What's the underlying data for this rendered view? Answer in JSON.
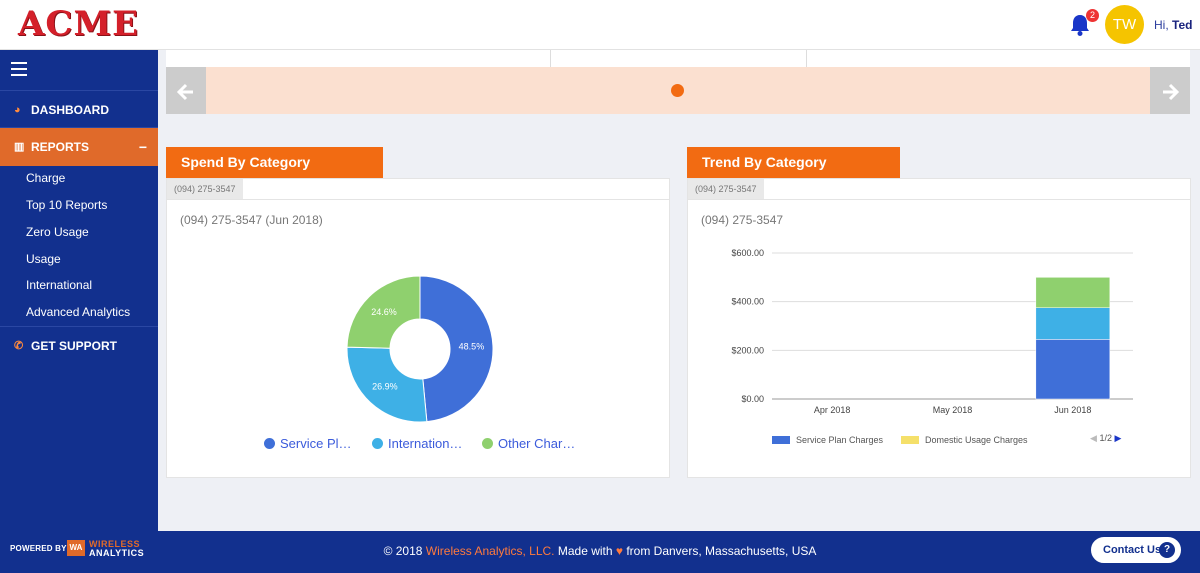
{
  "header": {
    "logo": "ACME",
    "notification_count": "2",
    "avatar_initials": "TW",
    "greeting_prefix": "Hi, ",
    "user_name": "Ted"
  },
  "sidebar": {
    "dashboard": "DASHBOARD",
    "reports": "REPORTS",
    "reports_toggle": "−",
    "sub_items": [
      "Charge",
      "Top 10 Reports",
      "Zero Usage",
      "Usage",
      "International",
      "Advanced Analytics"
    ],
    "support": "GET SUPPORT"
  },
  "carousel": {
    "prev_icon": "arrow-left-icon",
    "next_icon": "arrow-right-icon",
    "active_dot": 1,
    "dot_count": 1
  },
  "spend_panel": {
    "title": "Spend By Category",
    "tag": "(094) 275-3547",
    "subtitle": "(094) 275-3547 (Jun 2018)",
    "legend": [
      {
        "label": "Service Pl…",
        "color": "#3f6fd8"
      },
      {
        "label": "Internation…",
        "color": "#3eb0e6"
      },
      {
        "label": "Other Char…",
        "color": "#8fd06e"
      }
    ]
  },
  "trend_panel": {
    "title": "Trend By Category",
    "tag": "(094) 275-3547",
    "subtitle": "(094) 275-3547",
    "legend": [
      {
        "label": "Service Plan Charges",
        "color": "#3f6fd8"
      },
      {
        "label": "Domestic Usage Charges",
        "color": "#f5e06a"
      }
    ],
    "pager": "1/2"
  },
  "chart_data": [
    {
      "type": "pie",
      "title": "(094) 275-3547 (Jun 2018)",
      "donut": true,
      "labels": [
        "Service Pl…",
        "Internation…",
        "Other Char…"
      ],
      "values": [
        48.5,
        26.9,
        24.6
      ],
      "value_labels": [
        "48.5%",
        "26.9%",
        "24.6%"
      ],
      "colors": [
        "#3f6fd8",
        "#3eb0e6",
        "#8fd06e"
      ],
      "legend": "bottom"
    },
    {
      "type": "bar",
      "stacked": true,
      "title": "(094) 275-3547",
      "categories": [
        "Apr 2018",
        "May 2018",
        "Jun 2018"
      ],
      "series": [
        {
          "name": "Service Plan Charges",
          "values": [
            0,
            0,
            245
          ],
          "color": "#3f6fd8"
        },
        {
          "values": [
            0,
            0,
            130
          ],
          "color": "#3eb0e6"
        },
        {
          "values": [
            0,
            0,
            125
          ],
          "color": "#8fd06e"
        }
      ],
      "yticks": [
        "$0.00",
        "$200.00",
        "$400.00",
        "$600.00"
      ],
      "ylim": [
        0,
        600
      ],
      "grid": true,
      "legend": "bottom"
    }
  ],
  "footer": {
    "powered_by": "POWERED BY",
    "wa_top": "WIRELESS",
    "wa_bottom": "ANALYTICS",
    "copyright_prefix": "© 2018 ",
    "copyright_brand": "Wireless Analytics, LLC.",
    "made_with": " Made with ",
    "heart": "♥",
    "from": " from Danvers, Massachusetts, USA",
    "contact": "Contact Us",
    "contact_icon": "?"
  }
}
